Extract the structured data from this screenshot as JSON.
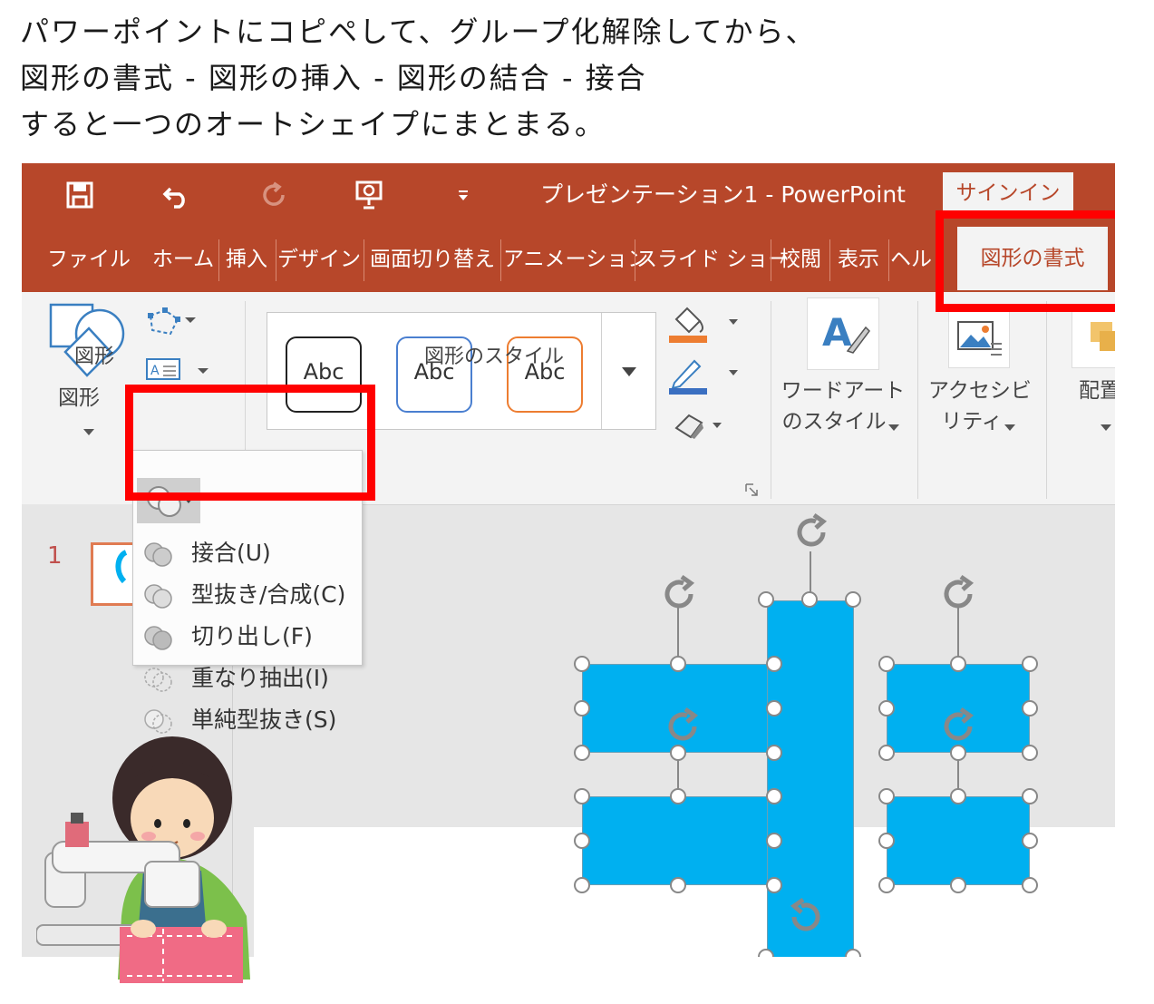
{
  "caption": {
    "lines": [
      "パワーポイントにコピペして、グループ化解除してから、",
      "図形の書式 - 図形の挿入 - 図形の結合 - 接合",
      "すると一つのオートシェイプにまとまる。"
    ]
  },
  "window": {
    "title": "プレゼンテーション1  -  PowerPoint",
    "signin": "サインイン"
  },
  "quick_access": [
    "save-icon",
    "undo-icon",
    "redo-icon",
    "slideshow-icon",
    "customize-icon"
  ],
  "tabs": [
    {
      "label": "ファイル"
    },
    {
      "label": "ホーム"
    },
    {
      "label": "挿入"
    },
    {
      "label": "デザイン"
    },
    {
      "label": "画面切り替え"
    },
    {
      "label": "アニメーション"
    },
    {
      "label": "スライド ショー"
    },
    {
      "label": "校閲"
    },
    {
      "label": "表示"
    },
    {
      "label": "ヘル"
    },
    {
      "label": "図形の書式",
      "active": true
    }
  ],
  "ribbon": {
    "insert_shapes": {
      "shapes_label": "図形",
      "group_label": "図形"
    },
    "shape_styles": {
      "presets": [
        "Abc",
        "Abc",
        "Abc"
      ],
      "group_label": "図形のスタイル"
    },
    "wordart": {
      "line1": "ワードアート",
      "line2": "のスタイル"
    },
    "accessibility": {
      "line1": "アクセシビ",
      "line2": "リティ"
    },
    "arrange": {
      "label": "配置"
    }
  },
  "merge_menu": {
    "items": [
      {
        "label": "接合(U)"
      },
      {
        "label": "型抜き/合成(C)"
      },
      {
        "label": "切り出し(F)"
      },
      {
        "label": "重なり抽出(I)"
      },
      {
        "label": "単純型抜き(S)"
      }
    ]
  },
  "slides_pane": {
    "slide_number": "1"
  },
  "colors": {
    "accent": "#b7472a",
    "shape_fill": "#00b0f0",
    "highlight": "#ff0000"
  }
}
